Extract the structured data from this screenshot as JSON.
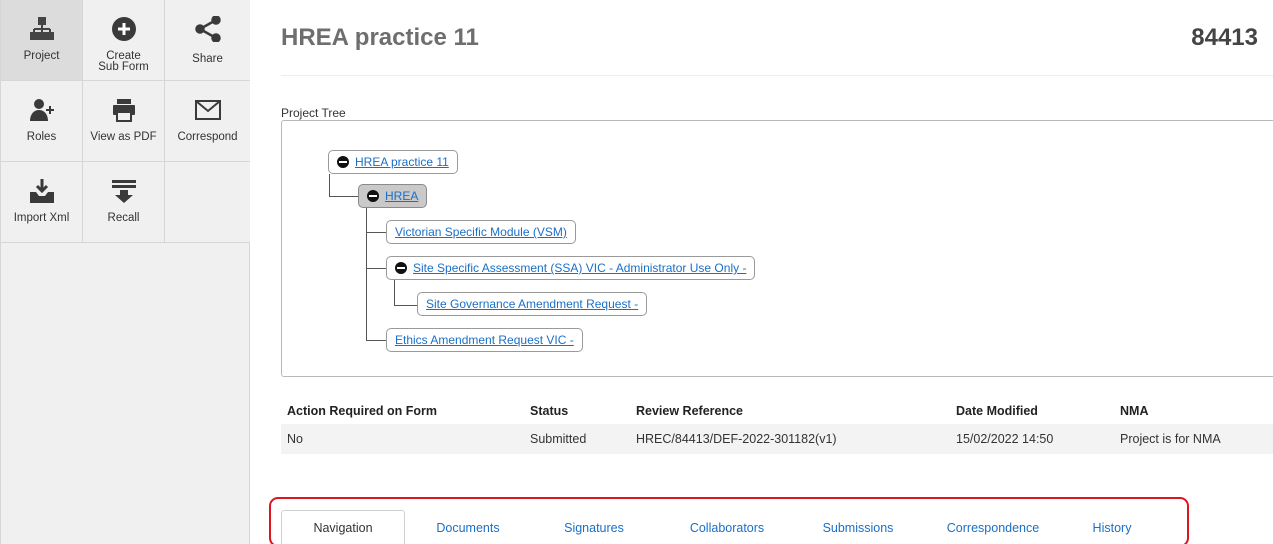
{
  "toolbar": {
    "buttons": [
      {
        "label": "Project",
        "icon": "hierarchy-icon"
      },
      {
        "label": "Create Sub Form",
        "icon": "plus-circle-icon"
      },
      {
        "label": "Share",
        "icon": "share-icon"
      },
      {
        "label": "Roles",
        "icon": "add-user-icon"
      },
      {
        "label": "View as PDF",
        "icon": "printer-icon"
      },
      {
        "label": "Correspond",
        "icon": "envelope-icon"
      },
      {
        "label": "Import Xml",
        "icon": "import-icon"
      },
      {
        "label": "Recall",
        "icon": "recall-icon"
      }
    ]
  },
  "header": {
    "title": "HREA practice 11",
    "project_id": "84413"
  },
  "project_tree": {
    "label": "Project Tree",
    "nodes": [
      {
        "text": "HREA practice 11",
        "collapsible": true
      },
      {
        "text": "HREA",
        "collapsible": true,
        "selected": true
      },
      {
        "text": "Victorian Specific Module (VSM)",
        "collapsible": false
      },
      {
        "text": "Site Specific Assessment (SSA) VIC - Administrator Use Only -",
        "collapsible": true
      },
      {
        "text": "Site Governance Amendment Request -",
        "collapsible": false
      },
      {
        "text": "Ethics Amendment Request VIC -",
        "collapsible": false
      }
    ]
  },
  "table": {
    "headers": [
      "Action Required on Form",
      "Status",
      "Review Reference",
      "Date Modified",
      "NMA"
    ],
    "row": [
      "No",
      "Submitted",
      "HREC/84413/DEF-2022-301182(v1)",
      "15/02/2022 14:50",
      "Project is for NMA"
    ]
  },
  "tabs": [
    "Navigation",
    "Documents",
    "Signatures",
    "Collaborators",
    "Submissions",
    "Correspondence",
    "History"
  ],
  "colors": {
    "link": "#1a6fc8",
    "highlight_border": "#e0141e",
    "toolbar_bg": "#f0f0f0"
  }
}
